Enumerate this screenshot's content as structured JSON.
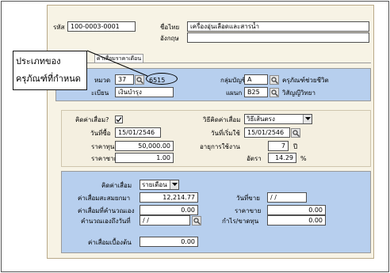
{
  "header": {
    "code_label": "รหัส",
    "code_value": "100-0003-0001",
    "thai_name_label": "ชื่อไทย",
    "thai_name_value": "เครื่องอุ่นเลือดและสารน้ำ",
    "eng_name_label": "อังกฤษ",
    "eng_name_value": ""
  },
  "tab": {
    "label": "ค่าเสื่อมราคาเดือน"
  },
  "callout": {
    "line1": "ประเภทของ",
    "line2": "ครุภัณฑ์ที่กำหนด"
  },
  "group": {
    "category_label": "หมวด",
    "category_value": "37",
    "category_desc": "6515",
    "account_label": "กลุ่มบัญชี",
    "account_value": "A",
    "account_desc": "ครุภัณฑ์ช่วยชีวิต",
    "budget_label": "ะเบียน",
    "budget_value": "เงินบำรุง",
    "dept_label": "แผนก",
    "dept_value": "B25",
    "dept_desc": "วิสัญญีวิทยา"
  },
  "depreciation": {
    "calc_label": "คิดค่าเสื่อม?",
    "calc_checked": true,
    "method_label": "วิธีคิดค่าเสื่อม",
    "method_value": "วิธีเส้นตรง",
    "buy_date_label": "วันที่ซื้อ",
    "buy_date_value": "15/01/2546",
    "start_date_label": "วันที่เริ่มใช้",
    "start_date_value": "15/01/2546",
    "cost_label": "ราคาทุน",
    "cost_value": "50,000.00",
    "life_label": "อายุการใช้งาน",
    "life_value": "7",
    "life_unit": "ปี",
    "salvage_label": "ราคาซาก",
    "salvage_value": "1.00",
    "rate_label": "อัตรา",
    "rate_value": "14.29",
    "rate_unit": "%"
  },
  "monthly": {
    "period_label": "คิดค่าเสื่อม",
    "period_value": "รายเดือน",
    "accum_label": "ค่าเสื่อมสะสมยกมา",
    "accum_value": "12,214.77",
    "sale_date_label": "วันที่ขาย",
    "sale_date_value": "/ /",
    "calc_dep_label": "ค่าเสื่อมที่คำนวณเอง",
    "calc_dep_value": "0.00",
    "sale_price_label": "ราคาขาย",
    "sale_price_value": "0.00",
    "calc_until_label": "คำนวณเองถึงวันที่",
    "calc_until_value": "/ /",
    "profit_label": "กำไร/ขาดทุน",
    "profit_value": "0.00",
    "begin_dep_label": "ค่าเสื่อมเบื้องต้น",
    "begin_dep_value": "0.00"
  }
}
